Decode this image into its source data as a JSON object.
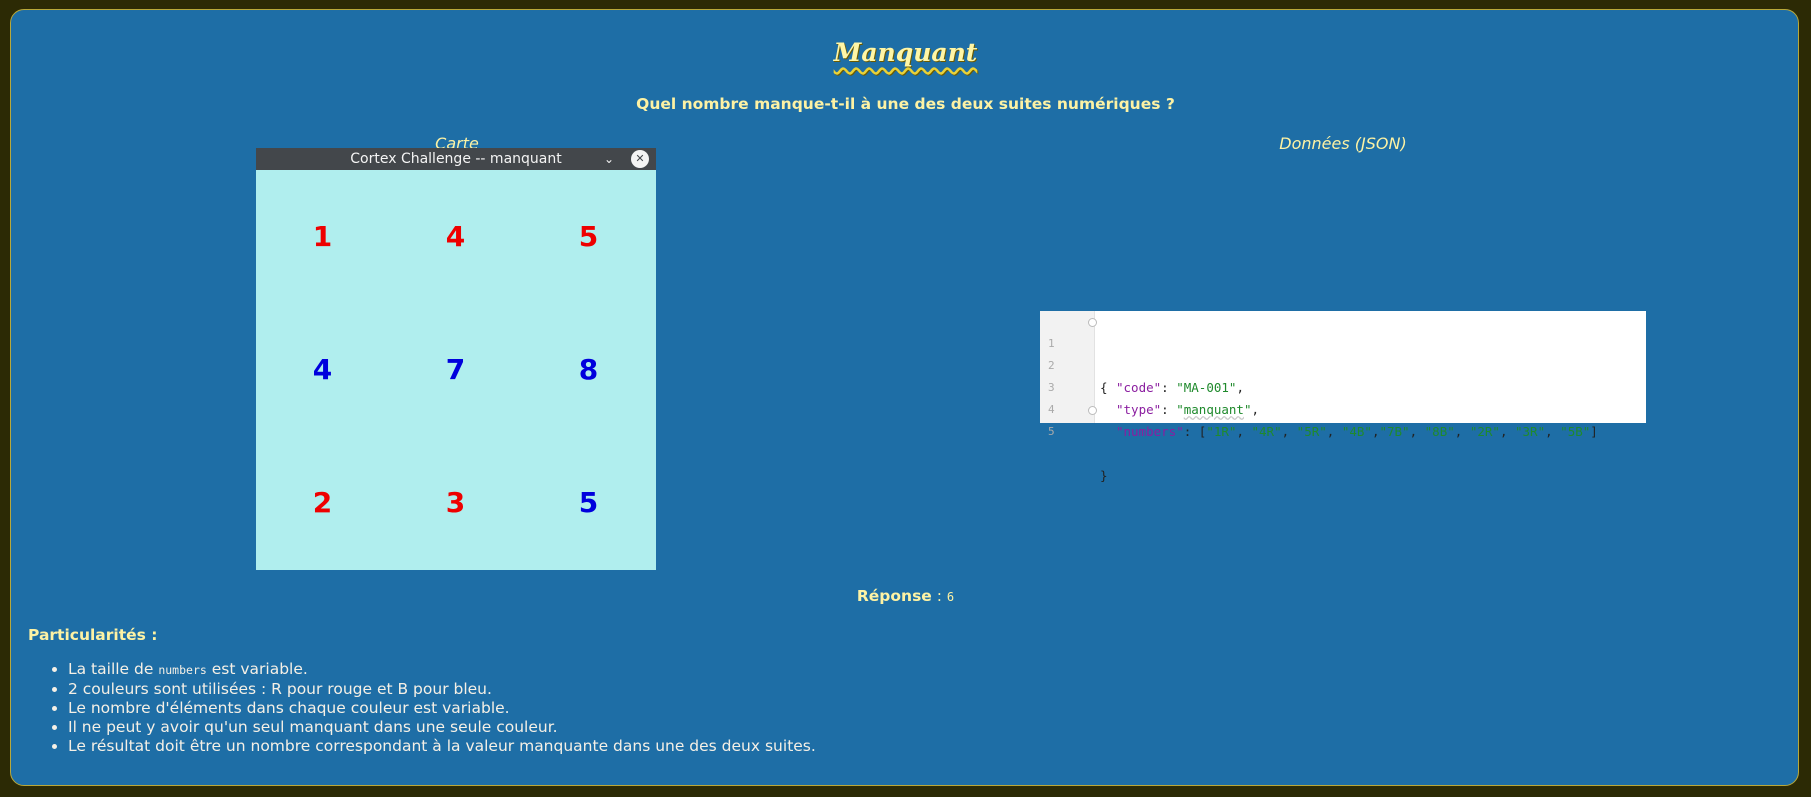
{
  "page": {
    "title": "Manquant",
    "question": "Quel nombre manque-t-il à une des deux suites numériques ?",
    "left_heading": "Carte",
    "right_heading": "Données (JSON)"
  },
  "window": {
    "title": "Cortex Challenge -- manquant",
    "chevron_glyph": "⌄",
    "close_glyph": "✕",
    "cells": [
      {
        "value": "1",
        "color": "#ee0000"
      },
      {
        "value": "4",
        "color": "#ee0000"
      },
      {
        "value": "5",
        "color": "#ee0000"
      },
      {
        "value": "4",
        "color": "#0000dd"
      },
      {
        "value": "7",
        "color": "#0000dd"
      },
      {
        "value": "8",
        "color": "#0000dd"
      },
      {
        "value": "2",
        "color": "#ee0000"
      },
      {
        "value": "3",
        "color": "#ee0000"
      },
      {
        "value": "5",
        "color": "#0000dd"
      }
    ]
  },
  "code": {
    "line_numbers": [
      "1",
      "2",
      "3",
      "4",
      "5"
    ],
    "open_brace": "{",
    "close_brace": "}",
    "code_key": "\"code\"",
    "code_value": "\"MA-001\"",
    "type_key": "\"type\"",
    "type_value_open": "\"",
    "type_value_word": "manquant",
    "type_value_close": "\"",
    "numbers_key": "\"numbers\"",
    "numbers_items": [
      "\"1R\"",
      "\"4R\"",
      "\"5R\"",
      "\"4B\"",
      "\"7B\"",
      "\"8B\"",
      "\"2R\"",
      "\"3R\"",
      "\"5B\""
    ],
    "sep_colon": ": ",
    "sep_comma": ",",
    "bracket_open": "[",
    "bracket_close": "]"
  },
  "answer": {
    "label": "Réponse",
    "separator": " : ",
    "value": "6"
  },
  "particularities": {
    "title": "Particularités :",
    "item1_pre": "La taille de ",
    "item1_code": "numbers",
    "item1_post": " est variable.",
    "item2": "2 couleurs sont utilisées : R pour rouge et B pour bleu.",
    "item3": "Le nombre d'éléments dans chaque couleur est variable.",
    "item4": "Il ne peut y avoir qu'un seul manquant dans une seule couleur.",
    "item5": "Le résultat doit être un nombre correspondant à la valeur manquante dans une des deux suites."
  }
}
